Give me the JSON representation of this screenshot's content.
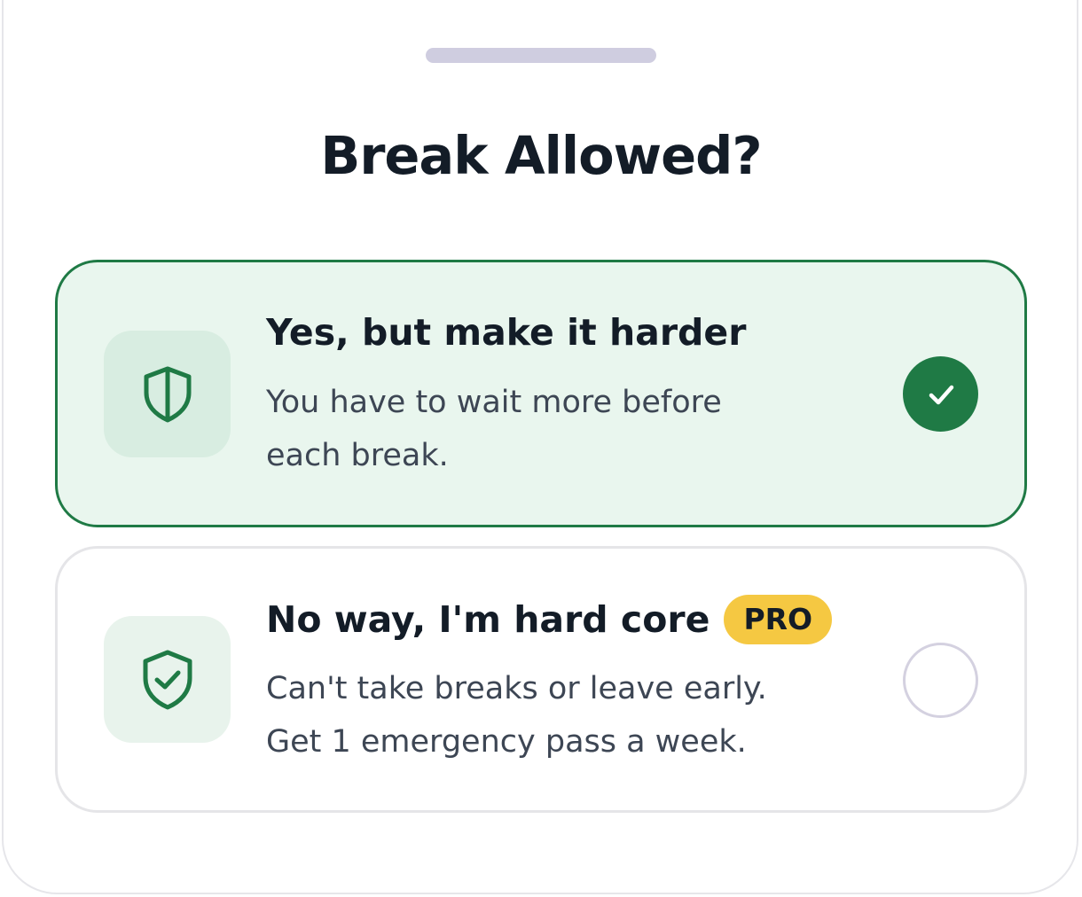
{
  "sheet": {
    "title": "Break Allowed?"
  },
  "options": [
    {
      "title": "Yes, but make it harder",
      "description_lines": [
        "You have to wait more before",
        "each break."
      ],
      "icon": "shield-icon",
      "selected": true
    },
    {
      "title": "No way, I'm hard core",
      "badge": "PRO",
      "description_lines": [
        "Can't take breaks or leave early.",
        "Get 1 emergency pass a week."
      ],
      "icon": "shield-check-icon",
      "selected": false
    }
  ],
  "colors": {
    "accent": "#1f7a45",
    "selected_background": "#e9f6ee",
    "pro_badge": "#f5c842",
    "title_text": "#131c27"
  }
}
